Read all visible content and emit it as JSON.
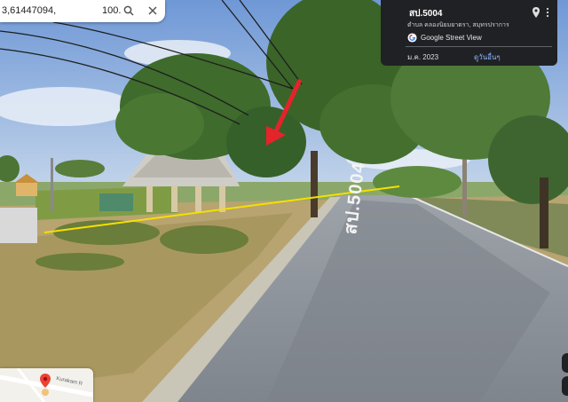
{
  "search": {
    "query": "3,61447094,",
    "zoom": "100."
  },
  "panel": {
    "title": "สป.5004",
    "subtitle": "ตำบล คลองนิยมยาตรา, สมุทรปราการ",
    "gsv_label": "Google Street View",
    "date": "ม.ค. 2023",
    "see_more": "ดูวันอื่นๆ"
  },
  "road_marking": "สป.5004",
  "minimap": {
    "road_label": "Kurakam R"
  },
  "colors": {
    "panel_bg": "#202124",
    "link": "#8ab4f8",
    "arrow": "#e5232b",
    "boundary_line": "#f5e000"
  },
  "icons": {
    "search": "search-icon",
    "close": "close-icon",
    "pin": "pin-icon",
    "more": "more-vert-icon",
    "google": "google-g-icon",
    "marker": "map-marker-icon"
  }
}
